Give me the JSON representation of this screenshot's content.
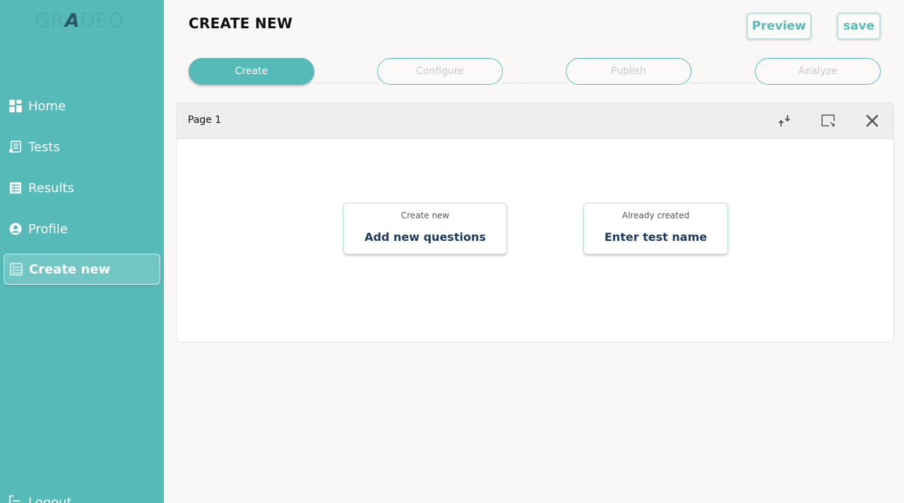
{
  "brand": {
    "logo_text": [
      "GR",
      "A",
      "DEO"
    ]
  },
  "sidebar": {
    "items": [
      {
        "label": "Home",
        "icon": "dashboard-icon"
      },
      {
        "label": "Tests",
        "icon": "test-list-icon"
      },
      {
        "label": "Results",
        "icon": "results-icon"
      },
      {
        "label": "Profile",
        "icon": "profile-icon"
      },
      {
        "label": "Create new",
        "icon": "create-list-icon",
        "active": true
      }
    ],
    "logout_label": "Logout"
  },
  "header": {
    "title": "CREATE NEW",
    "preview_label": "Preview",
    "save_label": "save"
  },
  "steps": [
    {
      "label": "Create",
      "active": true
    },
    {
      "label": "Configure",
      "active": false
    },
    {
      "label": "Publish",
      "active": false
    },
    {
      "label": "Analyze",
      "active": false
    }
  ],
  "page_panel": {
    "title": "Page 1",
    "icons": [
      "collapse-arrows-icon",
      "edit-frame-icon",
      "close-icon"
    ],
    "cards": [
      {
        "subtitle": "Create new",
        "title": "Add new questions"
      },
      {
        "subtitle": "Already created",
        "title": "Enter test name"
      }
    ]
  },
  "colors": {
    "accent": "#56bab9",
    "sidebar_bg": "#56bab9",
    "heading_navy": "#1c3a5f"
  }
}
